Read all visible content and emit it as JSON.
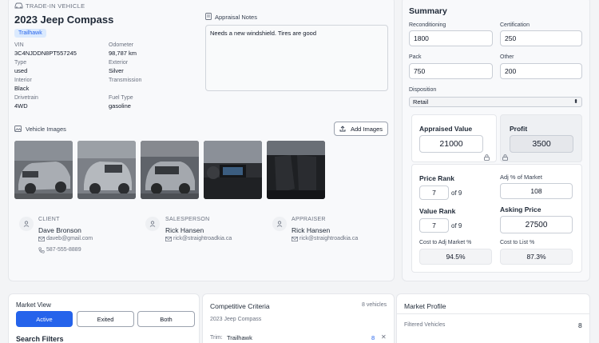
{
  "trade_in": {
    "section_label": "TRADE-IN VEHICLE",
    "title": "2023 Jeep Compass",
    "trim_badge": "Trailhawk",
    "fields": [
      {
        "label": "VIN",
        "value": "3C4NJDDN8PT557245"
      },
      {
        "label": "Odometer",
        "value": "98,787 km"
      },
      {
        "label": "Type",
        "value": "used"
      },
      {
        "label": "Exterior",
        "value": "Silver"
      },
      {
        "label": "Interior",
        "value": "Black"
      },
      {
        "label": "Transmission",
        "value": ""
      },
      {
        "label": "Drivetrain",
        "value": "4WD"
      },
      {
        "label": "Fuel Type",
        "value": "gasoline"
      }
    ],
    "notes_label": "Appraisal Notes",
    "notes_value": "Needs a new windshield. Tires are good",
    "images_label": "Vehicle Images",
    "add_images_label": "Add Images",
    "contacts": [
      {
        "role": "CLIENT",
        "name": "Dave Bronson",
        "email": "daveb@gmail.com",
        "phone": "587-555-8889"
      },
      {
        "role": "SALESPERSON",
        "name": "Rick Hansen",
        "email": "rick@straightroadkia.ca"
      },
      {
        "role": "APPRAISER",
        "name": "Rick Hansen",
        "email": "rick@straightroadkia.ca"
      }
    ]
  },
  "summary": {
    "title": "Summary",
    "reconditioning_label": "Reconditioning",
    "reconditioning_value": "1800",
    "certification_label": "Certification",
    "certification_value": "250",
    "pack_label": "Pack",
    "pack_value": "750",
    "other_label": "Other",
    "other_value": "200",
    "disposition_label": "Disposition",
    "disposition_value": "Retail",
    "appraised_label": "Appraised Value",
    "appraised_value": "21000",
    "profit_label": "Profit",
    "profit_value": "3500",
    "price_rank_label": "Price Rank",
    "price_rank_value": "7",
    "price_rank_of": "of 9",
    "adj_market_label": "Adj % of Market",
    "adj_market_value": "108",
    "value_rank_label": "Value Rank",
    "value_rank_value": "7",
    "value_rank_of": "of 9",
    "asking_label": "Asking Price",
    "asking_value": "27500",
    "cost_adj_label": "Cost to Adj Market %",
    "cost_adj_value": "94.5%",
    "cost_list_label": "Cost to List %",
    "cost_list_value": "87.3%"
  },
  "market_view": {
    "label": "Market View",
    "tabs": [
      "Active",
      "Exited",
      "Both"
    ],
    "filters_label": "Search Filters"
  },
  "competitive": {
    "title": "Competitive Criteria",
    "count": "8 vehicles",
    "vehicle": "2023 Jeep Compass",
    "trim_label": "Trim:",
    "trim_value": "Trailhawk",
    "trim_count": "8"
  },
  "market_profile": {
    "title": "Market Profile",
    "filtered_label": "Filtered Vehicles",
    "filtered_value": "8"
  },
  "colors": {
    "accent": "#2563eb",
    "panel": "#f8f9fb",
    "border": "#e5e7eb"
  }
}
